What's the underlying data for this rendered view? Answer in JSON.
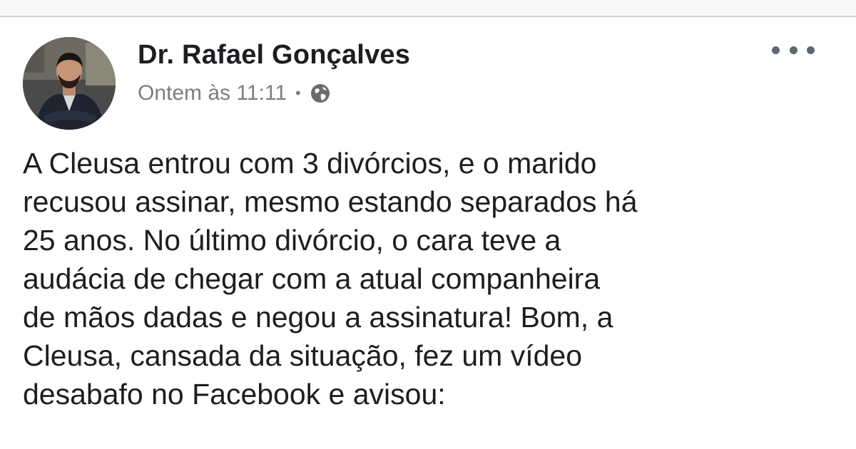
{
  "post": {
    "author": "Dr. Rafael Gonçalves",
    "timestamp": "Ontem às 11:11",
    "separator": "•",
    "privacy_icon": "globe-icon",
    "more_icon": "more-options-icon",
    "body_lines": [
      "A Cleusa entrou com 3 divórcios, e o marido",
      "recusou assinar, mesmo estando separados há",
      "25 anos. No último divórcio, o cara teve a",
      "audácia de chegar com a atual companheira",
      "de mãos dadas e negou a assinatura! Bom, a",
      "Cleusa, cansada da situação, fez um vídeo",
      "desabafo no Facebook e avisou:"
    ]
  },
  "colors": {
    "text": "#1c1e21",
    "meta_text": "#7d7d7d",
    "background": "#ffffff"
  }
}
